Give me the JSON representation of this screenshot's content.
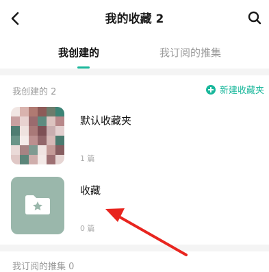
{
  "header": {
    "title": "我的收藏 2",
    "back_icon": "chevron-left-icon",
    "search_icon": "search-icon"
  },
  "tabs": [
    {
      "label": "我创建的",
      "active": true
    },
    {
      "label": "我订阅的推集",
      "active": false
    }
  ],
  "created_section": {
    "title": "我创建的 2",
    "new_folder_label": "新建收藏夹"
  },
  "folders": [
    {
      "name": "默认收藏夹",
      "count": "1 篇",
      "thumbnail": "pixelated-photo"
    },
    {
      "name": "收藏",
      "count": "0 篇",
      "thumbnail": "folder-star-icon"
    }
  ],
  "subscribed_section": {
    "title": "我订阅的推集 0"
  },
  "colors": {
    "accent": "#19b79b",
    "annotation_arrow": "#e8251f",
    "folder_thumb_bg": "#9ab7ab"
  }
}
